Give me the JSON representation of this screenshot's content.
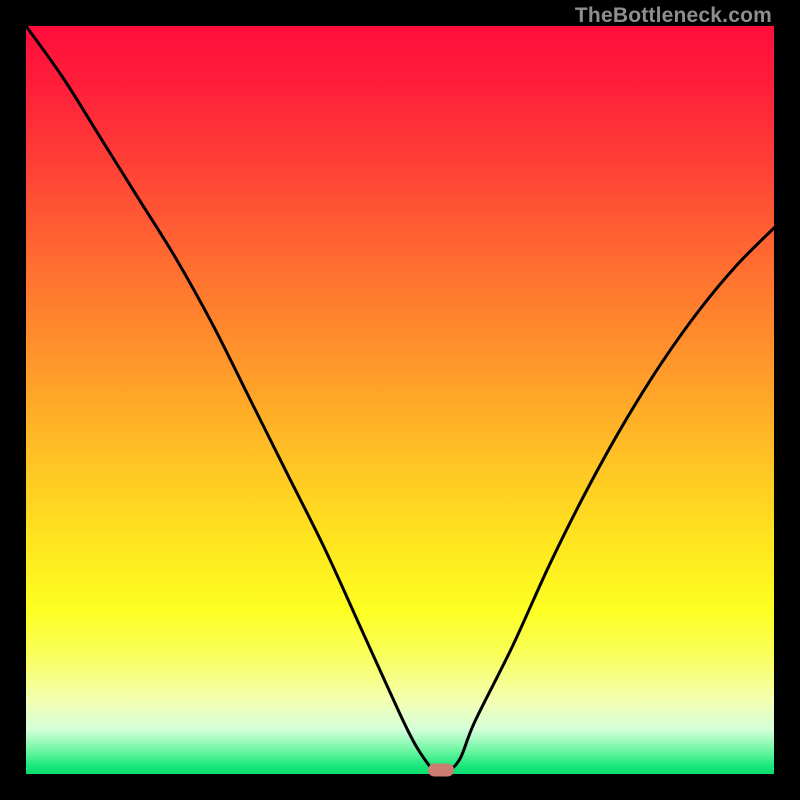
{
  "watermark": "TheBottleneck.com",
  "chart_data": {
    "type": "line",
    "title": "",
    "xlabel": "",
    "ylabel": "",
    "xlim": [
      0,
      100
    ],
    "ylim": [
      0,
      100
    ],
    "series": [
      {
        "name": "bottleneck-curve",
        "x": [
          0,
          5,
          10,
          15,
          20,
          25,
          30,
          35,
          40,
          45,
          50,
          52,
          54,
          55,
          56,
          58,
          60,
          65,
          70,
          75,
          80,
          85,
          90,
          95,
          100
        ],
        "values": [
          100,
          93,
          85,
          77,
          69,
          60,
          50,
          40,
          30,
          19,
          8,
          4,
          1,
          0,
          0,
          2,
          7,
          17,
          28,
          38,
          47,
          55,
          62,
          68,
          73
        ]
      }
    ],
    "marker": {
      "x": 55.5,
      "y": 0
    },
    "background_gradient": {
      "top": "#ff0d3b",
      "mid": "#ffe81f",
      "bottom": "#0adf6e"
    }
  }
}
